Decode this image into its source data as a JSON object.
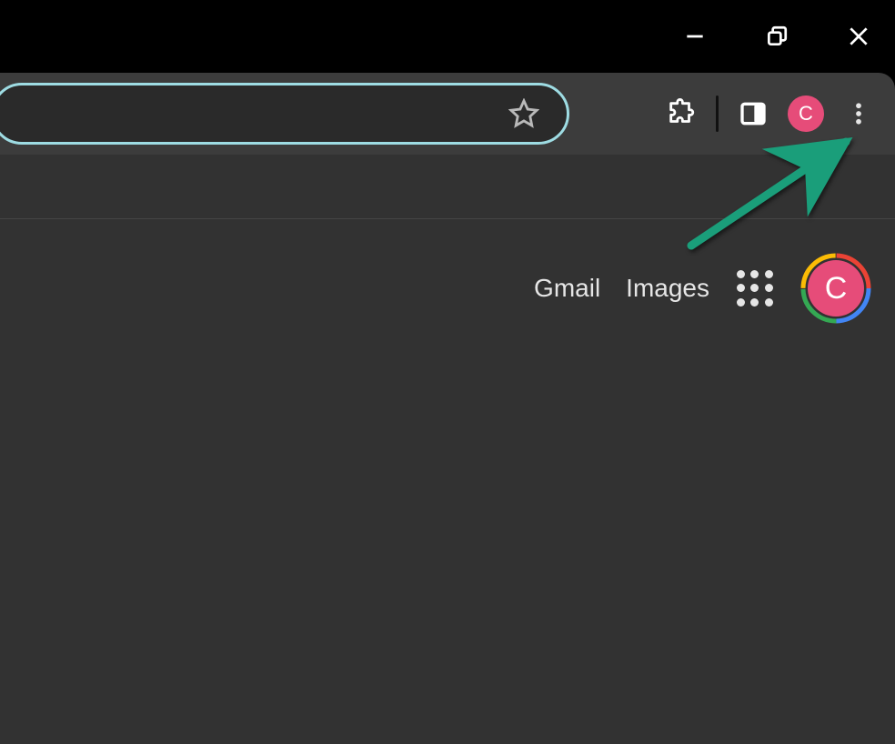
{
  "window_controls": {
    "minimize": "minimize",
    "maximize": "maximize-restore",
    "close": "close"
  },
  "toolbar": {
    "omnibox_value": "",
    "bookmark_icon": "star-icon",
    "extensions_icon": "extensions-icon",
    "sidepanel_icon": "side-panel-icon",
    "profile_initial": "C",
    "menu_icon": "more-vertical-icon"
  },
  "page_header": {
    "gmail_label": "Gmail",
    "images_label": "Images",
    "apps_icon": "apps-grid-icon",
    "account_initial": "C"
  },
  "annotation": "arrow-to-menu"
}
